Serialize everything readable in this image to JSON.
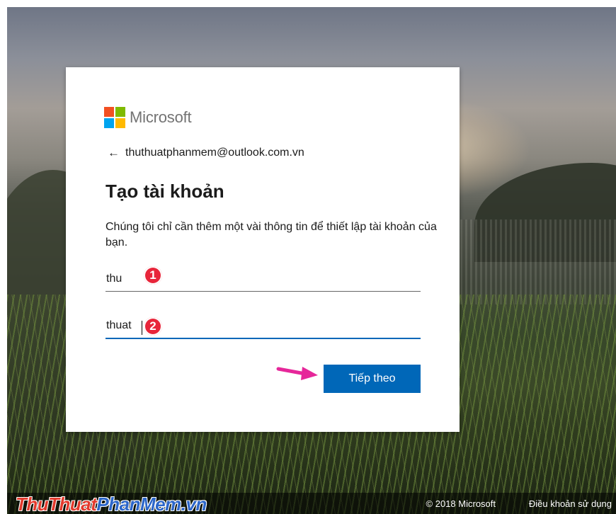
{
  "brand": {
    "name": "Microsoft",
    "colors": [
      "#f25022",
      "#7fba00",
      "#00a4ef",
      "#ffb900"
    ]
  },
  "signup": {
    "back_icon": "left-arrow-icon",
    "email": "thuthuatphanmem@outlook.com.vn",
    "title": "Tạo tài khoản",
    "description": "Chúng tôi chỉ cần thêm một vài thông tin để thiết lập tài khoản của bạn.",
    "first_name_value": "thu",
    "last_name_value": "thuat",
    "next_label": "Tiếp theo",
    "accent": "#0067b8"
  },
  "annotations": {
    "step1": "1",
    "step2": "2",
    "badge_color": "#e8253a",
    "arrow_color": "#e6279a"
  },
  "footer": {
    "watermark_part1": "ThuThuat",
    "watermark_part2": "PhanMem",
    "watermark_part3": ".vn",
    "copyright": "© 2018 Microsoft",
    "terms": "Điều khoản sử dụng"
  }
}
